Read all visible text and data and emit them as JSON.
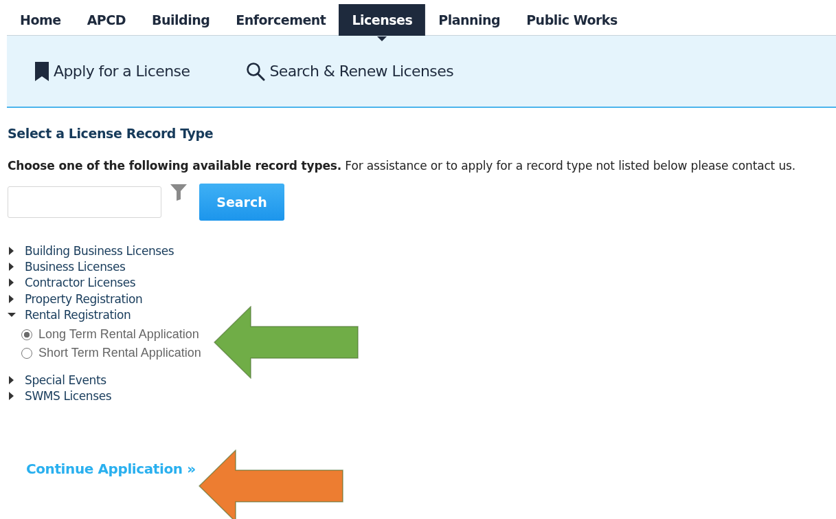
{
  "tabs": [
    {
      "label": "Home",
      "selected": false
    },
    {
      "label": "APCD",
      "selected": false
    },
    {
      "label": "Building",
      "selected": false
    },
    {
      "label": "Enforcement",
      "selected": false
    },
    {
      "label": "Licenses",
      "selected": true
    },
    {
      "label": "Planning",
      "selected": false
    },
    {
      "label": "Public Works",
      "selected": false
    }
  ],
  "subnav": [
    {
      "kind": "bookmark",
      "label": "Apply for a License"
    },
    {
      "kind": "search",
      "label": "Search & Renew Licenses"
    }
  ],
  "section_title": "Select a License Record Type",
  "instructions": "**Choose one of the following available record types.** For assistance or to apply for a record type not listed below please contact us.",
  "search": {
    "button": "Search"
  },
  "tree": [
    {
      "label": "Building Business Licenses",
      "expanded": false
    },
    {
      "label": "Business Licenses",
      "expanded": false
    },
    {
      "label": "Contractor Licenses",
      "expanded": false
    },
    {
      "label": "Property Registration",
      "expanded": false
    },
    {
      "label": "Rental Registration",
      "expanded": true,
      "children": [
        {
          "label": "Long Term Rental Application",
          "selected": true
        },
        {
          "label": "Short Term Rental Application",
          "selected": false
        }
      ]
    },
    {
      "label": "Special Events",
      "expanded": false
    },
    {
      "label": "SWMS Licenses",
      "expanded": false
    }
  ],
  "continue_link": "Continue Application »",
  "annotation_arrows": [
    {
      "color": "#70ad47"
    },
    {
      "color": "#ed7d31"
    }
  ]
}
